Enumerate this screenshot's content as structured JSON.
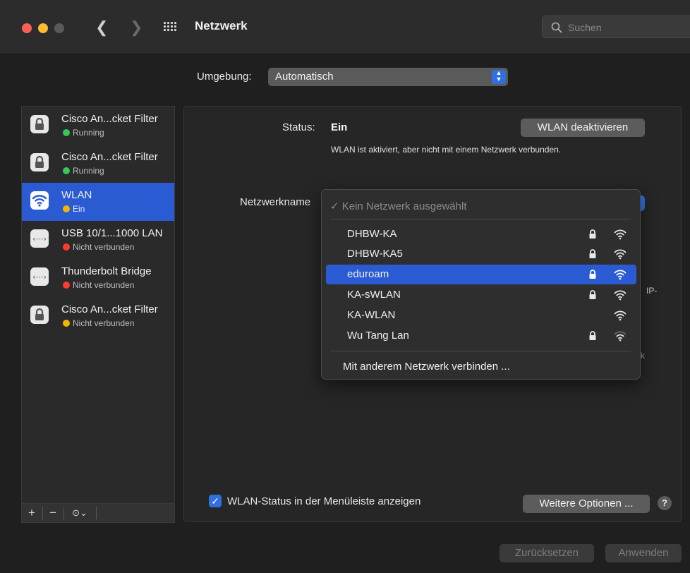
{
  "window": {
    "title": "Netzwerk",
    "search": {
      "placeholder": "Suchen"
    }
  },
  "location": {
    "label": "Umgebung:",
    "value": "Automatisch"
  },
  "sidebar": {
    "services": [
      {
        "name": "Cisco An...cket Filter",
        "status": "Running",
        "status_color": "#34c759",
        "icon": "lock-icon"
      },
      {
        "name": "Cisco An...cket Filter",
        "status": "Running",
        "status_color": "#34c759",
        "icon": "lock-icon"
      },
      {
        "name": "WLAN",
        "status": "Ein",
        "status_color": "#f4b400",
        "icon": "wifi-icon",
        "selected": true
      },
      {
        "name": "USB 10/1...1000 LAN",
        "status": "Nicht verbunden",
        "status_color": "#ff3b30",
        "icon": "ethernet-icon"
      },
      {
        "name": "Thunderbolt Bridge",
        "status": "Nicht verbunden",
        "status_color": "#ff3b30",
        "icon": "ethernet-icon"
      },
      {
        "name": "Cisco An...cket Filter",
        "status": "Nicht verbunden",
        "status_color": "#f4b400",
        "icon": "lock-icon"
      }
    ],
    "tools": {
      "add": "+",
      "remove": "−",
      "more": "⊙⌄"
    }
  },
  "panel": {
    "status_label": "Status:",
    "status_value": "Ein",
    "toggle_button": "WLAN deaktivieren",
    "status_description": "WLAN ist aktiviert, aber nicht mit einem Netzwerk verbunden.",
    "network_name_label": "Netzwerkname",
    "peek_text_right": "IP-",
    "peek_text_right2": "k",
    "menubar_checkbox_label": "WLAN-Status in der Menüleiste anzeigen",
    "menubar_checkbox_checked": true,
    "advanced_button": "Weitere Optionen ...",
    "help": "?"
  },
  "network_menu": {
    "none_selected": "✓ Kein Netzwerk ausgewählt",
    "networks": [
      {
        "name": "DHBW-KA",
        "locked": true,
        "signal": "strong"
      },
      {
        "name": "DHBW-KA5",
        "locked": true,
        "signal": "strong"
      },
      {
        "name": "eduroam",
        "locked": true,
        "signal": "strong",
        "highlighted": true
      },
      {
        "name": "KA-sWLAN",
        "locked": true,
        "signal": "strong"
      },
      {
        "name": "KA-WLAN",
        "locked": false,
        "signal": "strong"
      },
      {
        "name": "Wu Tang Lan",
        "locked": true,
        "signal": "weak"
      }
    ],
    "join_other": "Mit anderem Netzwerk verbinden ..."
  },
  "footer": {
    "revert": "Zurücksetzen",
    "apply": "Anwenden"
  },
  "colors": {
    "accent": "#2b5bd2",
    "window_bg": "#1f1f1f"
  }
}
